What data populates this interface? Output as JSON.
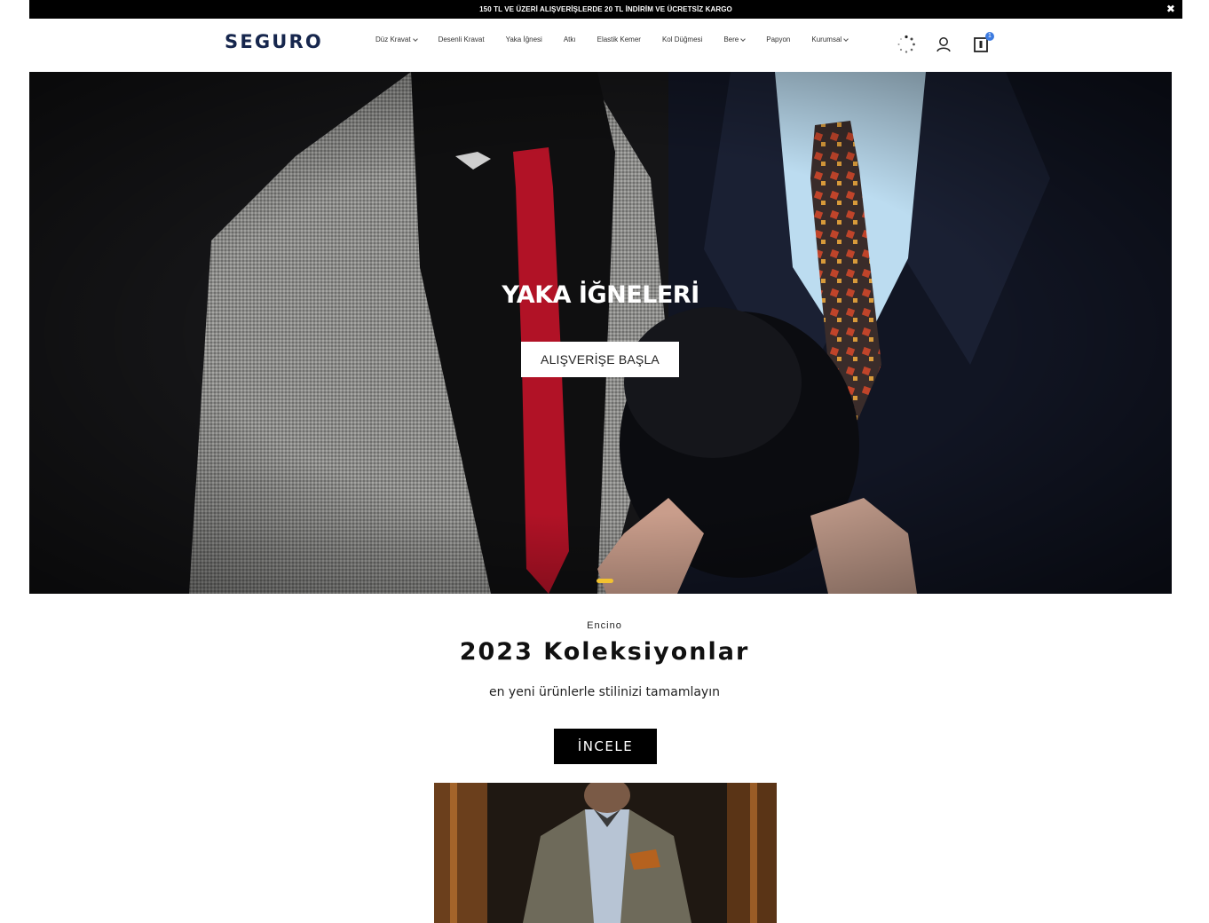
{
  "announcement": {
    "text": "150 TL VE ÜZERİ ALIŞVERİŞLERDE 20 TL İNDİRİM VE ÜCRETSİZ KARGO",
    "close_glyph": "✖"
  },
  "header": {
    "logo": "SEGURO",
    "nav": [
      {
        "label": "Düz Kravat",
        "has_dropdown": true
      },
      {
        "label": "Desenli Kravat",
        "has_dropdown": false
      },
      {
        "label": "Yaka İğnesi",
        "has_dropdown": false
      },
      {
        "label": "Atkı",
        "has_dropdown": false
      },
      {
        "label": "Elastik Kemer",
        "has_dropdown": false
      },
      {
        "label": "Kol Düğmesi",
        "has_dropdown": false
      },
      {
        "label": "Bere",
        "has_dropdown": true
      },
      {
        "label": "Papyon",
        "has_dropdown": false
      },
      {
        "label": "Kurumsal",
        "has_dropdown": true
      }
    ],
    "icons": [
      "loading-spinner-icon",
      "user-icon",
      "cart-icon"
    ],
    "cart_count": "1"
  },
  "hero": {
    "title": "YAKA İĞNELERİ",
    "button": "ALIŞVERİŞE BAŞLA",
    "active_slide": 1
  },
  "collection": {
    "eyebrow": "Encino",
    "title": "2023 Koleksiyonlar",
    "subtitle": "en yeni ürünlerle stilinizi tamamlayın",
    "button": "İNCELE"
  },
  "colors": {
    "logo": "#16264d",
    "accent_dot": "#f2c230",
    "badge": "#3d7be0"
  }
}
